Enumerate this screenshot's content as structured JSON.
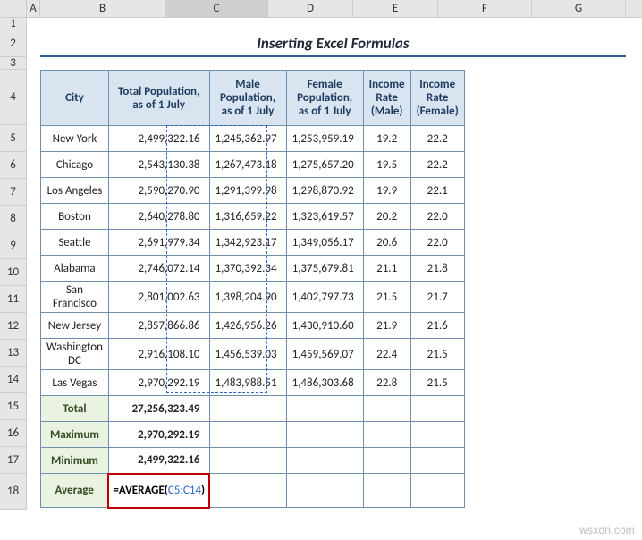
{
  "columns": {
    "A": "A",
    "B": "B",
    "C": "C",
    "D": "D",
    "E": "E",
    "F": "F",
    "G": "G"
  },
  "rows": {
    "r1": "1",
    "r2": "2",
    "r3": "3",
    "r4": "4",
    "r5": "5",
    "r6": "6",
    "r7": "7",
    "r8": "8",
    "r9": "9",
    "r10": "10",
    "r11": "11",
    "r12": "12",
    "r13": "13",
    "r14": "14",
    "r15": "15",
    "r16": "16",
    "r17": "17",
    "r18": "18"
  },
  "title": "Inserting Excel Formulas",
  "headers": {
    "city": "City",
    "total": "Total Population, as of 1 July",
    "male": "Male Population, as of 1 July",
    "female": "Female Population, as of 1 July",
    "rate_m": "Income Rate (Male)",
    "rate_f": "Income Rate (Female)"
  },
  "data": [
    {
      "city": "New York",
      "total": "2,499,322.16",
      "male": "1,245,362.97",
      "female": "1,253,959.19",
      "rm": "19.2",
      "rf": "22.2"
    },
    {
      "city": "Chicago",
      "total": "2,543,130.38",
      "male": "1,267,473.18",
      "female": "1,275,657.20",
      "rm": "19.5",
      "rf": "22.2"
    },
    {
      "city": "Los Angeles",
      "total": "2,590,270.90",
      "male": "1,291,399.98",
      "female": "1,298,870.92",
      "rm": "19.9",
      "rf": "22.1"
    },
    {
      "city": "Boston",
      "total": "2,640,278.80",
      "male": "1,316,659.22",
      "female": "1,323,619.57",
      "rm": "20.2",
      "rf": "22.0"
    },
    {
      "city": "Seattle",
      "total": "2,691,979.34",
      "male": "1,342,923.17",
      "female": "1,349,056.17",
      "rm": "20.6",
      "rf": "22.0"
    },
    {
      "city": "Alabama",
      "total": "2,746,072.14",
      "male": "1,370,392.34",
      "female": "1,375,679.81",
      "rm": "21.1",
      "rf": "21.8"
    },
    {
      "city": "San Francisco",
      "total": "2,801,002.63",
      "male": "1,398,204.90",
      "female": "1,402,797.73",
      "rm": "21.5",
      "rf": "21.7"
    },
    {
      "city": "New Jersey",
      "total": "2,857,866.86",
      "male": "1,426,956.26",
      "female": "1,430,910.60",
      "rm": "21.9",
      "rf": "21.6"
    },
    {
      "city": "Washington DC",
      "total": "2,916,108.10",
      "male": "1,456,539.03",
      "female": "1,459,569.07",
      "rm": "22.4",
      "rf": "21.5"
    },
    {
      "city": "Las Vegas",
      "total": "2,970,292.19",
      "male": "1,483,988.51",
      "female": "1,486,303.68",
      "rm": "22.8",
      "rf": "21.5"
    }
  ],
  "summary": {
    "total": {
      "label": "Total",
      "value": "27,256,323.49"
    },
    "max": {
      "label": "Maximum",
      "value": "2,970,292.19"
    },
    "min": {
      "label": "Minimum",
      "value": "2,499,322.16"
    },
    "avg": {
      "label": "Average",
      "formula_prefix": "=AVERAGE(",
      "formula_ref": "C5:C14",
      "formula_suffix": ")"
    }
  },
  "watermark": "wsxdn.com"
}
